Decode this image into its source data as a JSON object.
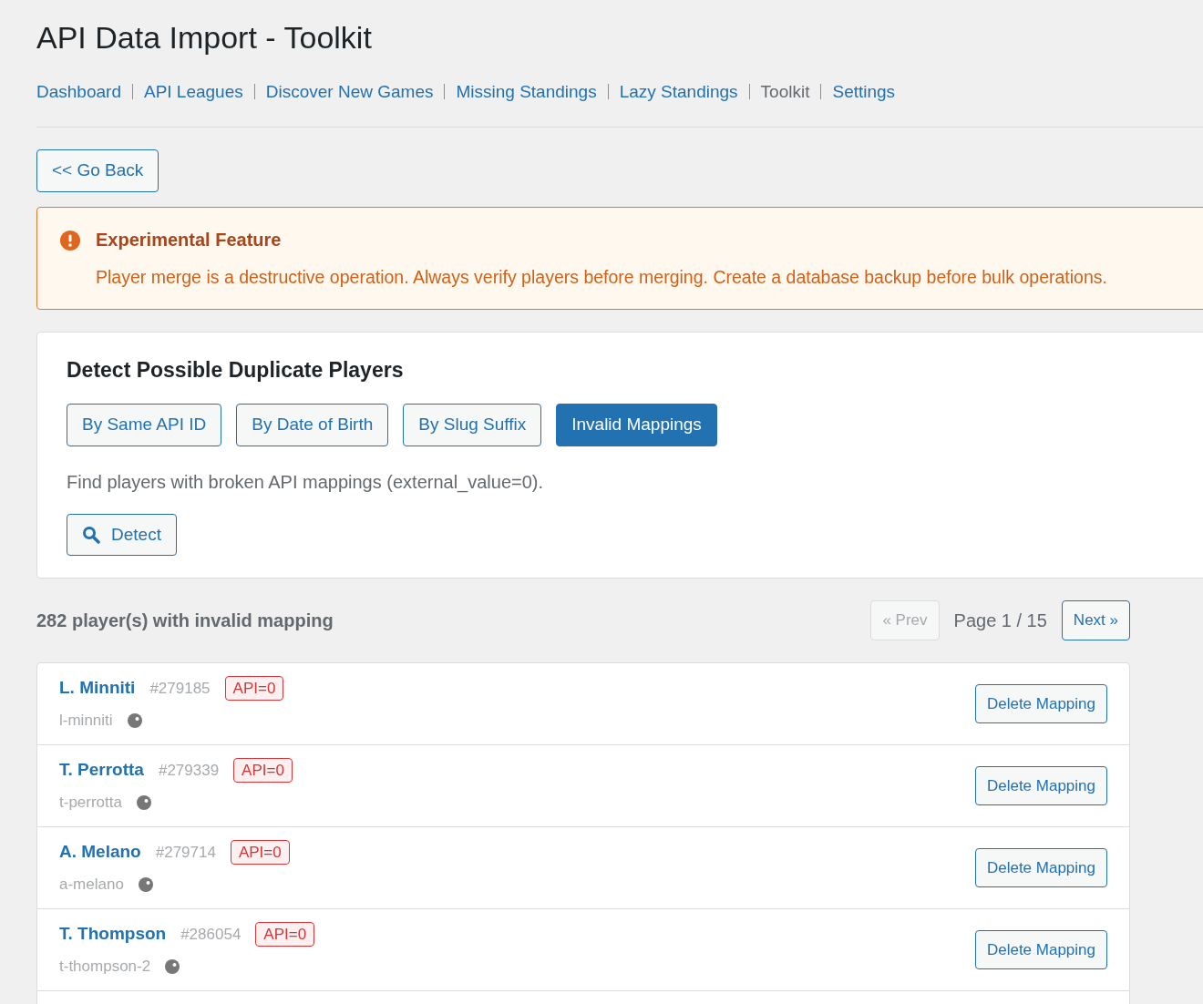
{
  "page_title": "API Data Import - Toolkit",
  "nav": [
    {
      "label": "Dashboard",
      "selected": false
    },
    {
      "label": "API Leagues",
      "selected": false
    },
    {
      "label": "Discover New Games",
      "selected": false
    },
    {
      "label": "Missing Standings",
      "selected": false
    },
    {
      "label": "Lazy Standings",
      "selected": false
    },
    {
      "label": "Toolkit",
      "selected": true
    },
    {
      "label": "Settings",
      "selected": false
    }
  ],
  "back_button": "<< Go Back",
  "notice": {
    "title": "Experimental Feature",
    "message": "Player merge is a destructive operation. Always verify players before merging. Create a database backup before bulk operations."
  },
  "detect_panel": {
    "title": "Detect Possible Duplicate Players",
    "modes": [
      {
        "label": "By Same API ID",
        "selected": false
      },
      {
        "label": "By Date of Birth",
        "selected": false
      },
      {
        "label": "By Slug Suffix",
        "selected": false
      },
      {
        "label": "Invalid Mappings",
        "selected": true
      }
    ],
    "description": "Find players with broken API mappings (external_value=0).",
    "detect_button": "Detect"
  },
  "results": {
    "summary": "282 player(s) with invalid mapping",
    "pagination": {
      "prev": {
        "label": "« Prev",
        "disabled": true
      },
      "page": "Page 1 / 15",
      "next": {
        "label": "Next »",
        "disabled": false
      }
    },
    "players": [
      {
        "name": "L. Minniti",
        "id": "#279185",
        "badge": "API=0",
        "slug": "l-minniti",
        "action": "Delete Mapping"
      },
      {
        "name": "T. Perrotta",
        "id": "#279339",
        "badge": "API=0",
        "slug": "t-perrotta",
        "action": "Delete Mapping"
      },
      {
        "name": "A. Melano",
        "id": "#279714",
        "badge": "API=0",
        "slug": "a-melano",
        "action": "Delete Mapping"
      },
      {
        "name": "T. Thompson",
        "id": "#286054",
        "badge": "API=0",
        "slug": "t-thompson-2",
        "action": "Delete Mapping"
      }
    ]
  }
}
